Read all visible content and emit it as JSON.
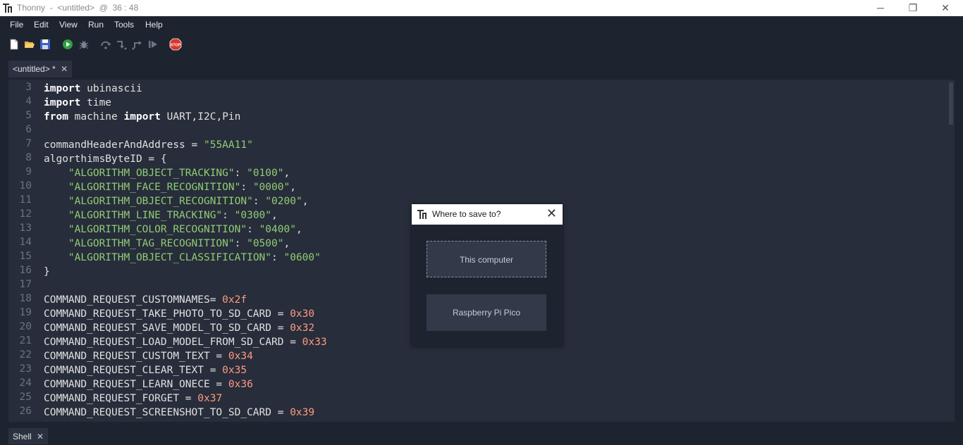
{
  "window": {
    "title": "Thonny  -  <untitled>  @  36 : 48",
    "minimize_glyph": "─",
    "restore_glyph": "❐",
    "close_glyph": "✕"
  },
  "menubar": {
    "items": [
      "File",
      "Edit",
      "View",
      "Run",
      "Tools",
      "Help"
    ]
  },
  "toolbar": {
    "icons": [
      "new-file-icon",
      "open-folder-icon",
      "save-icon",
      "run-icon",
      "debug-icon",
      "step-over-icon",
      "step-into-icon",
      "step-out-icon",
      "resume-icon",
      "stop-icon"
    ],
    "stop_label": "STOP"
  },
  "editor": {
    "tab_label": "<untitled> *",
    "tab_close": "✕",
    "line_numbers": [
      "3",
      "4",
      "5",
      "6",
      "7",
      "8",
      "9",
      "10",
      "11",
      "12",
      "13",
      "14",
      "15",
      "16",
      "17",
      "18",
      "19",
      "20",
      "21",
      "22",
      "23",
      "24",
      "25",
      "26"
    ]
  },
  "code_lines": [
    [
      {
        "t": "import",
        "c": "kw"
      },
      {
        "t": " ubinascii",
        "c": ""
      }
    ],
    [
      {
        "t": "import",
        "c": "kw"
      },
      {
        "t": " time",
        "c": ""
      }
    ],
    [
      {
        "t": "from",
        "c": "kw"
      },
      {
        "t": " machine ",
        "c": ""
      },
      {
        "t": "import",
        "c": "kw"
      },
      {
        "t": " UART,I2C,Pin",
        "c": ""
      }
    ],
    [],
    [
      {
        "t": "commandHeaderAndAddress = ",
        "c": ""
      },
      {
        "t": "\"55AA11\"",
        "c": "str"
      }
    ],
    [
      {
        "t": "algorthimsByteID = {",
        "c": ""
      }
    ],
    [
      {
        "t": "    ",
        "c": ""
      },
      {
        "t": "\"ALGORITHM_OBJECT_TRACKING\"",
        "c": "str"
      },
      {
        "t": ": ",
        "c": ""
      },
      {
        "t": "\"0100\"",
        "c": "str"
      },
      {
        "t": ",",
        "c": ""
      }
    ],
    [
      {
        "t": "    ",
        "c": ""
      },
      {
        "t": "\"ALGORITHM_FACE_RECOGNITION\"",
        "c": "str"
      },
      {
        "t": ": ",
        "c": ""
      },
      {
        "t": "\"0000\"",
        "c": "str"
      },
      {
        "t": ",",
        "c": ""
      }
    ],
    [
      {
        "t": "    ",
        "c": ""
      },
      {
        "t": "\"ALGORITHM_OBJECT_RECOGNITION\"",
        "c": "str"
      },
      {
        "t": ": ",
        "c": ""
      },
      {
        "t": "\"0200\"",
        "c": "str"
      },
      {
        "t": ",",
        "c": ""
      }
    ],
    [
      {
        "t": "    ",
        "c": ""
      },
      {
        "t": "\"ALGORITHM_LINE_TRACKING\"",
        "c": "str"
      },
      {
        "t": ": ",
        "c": ""
      },
      {
        "t": "\"0300\"",
        "c": "str"
      },
      {
        "t": ",",
        "c": ""
      }
    ],
    [
      {
        "t": "    ",
        "c": ""
      },
      {
        "t": "\"ALGORITHM_COLOR_RECOGNITION\"",
        "c": "str"
      },
      {
        "t": ": ",
        "c": ""
      },
      {
        "t": "\"0400\"",
        "c": "str"
      },
      {
        "t": ",",
        "c": ""
      }
    ],
    [
      {
        "t": "    ",
        "c": ""
      },
      {
        "t": "\"ALGORITHM_TAG_RECOGNITION\"",
        "c": "str"
      },
      {
        "t": ": ",
        "c": ""
      },
      {
        "t": "\"0500\"",
        "c": "str"
      },
      {
        "t": ",",
        "c": ""
      }
    ],
    [
      {
        "t": "    ",
        "c": ""
      },
      {
        "t": "\"ALGORITHM_OBJECT_CLASSIFICATION\"",
        "c": "str"
      },
      {
        "t": ": ",
        "c": ""
      },
      {
        "t": "\"0600\"",
        "c": "str"
      }
    ],
    [
      {
        "t": "}",
        "c": ""
      }
    ],
    [],
    [
      {
        "t": "COMMAND_REQUEST_CUSTOMNAMES= ",
        "c": ""
      },
      {
        "t": "0x2f",
        "c": "num"
      }
    ],
    [
      {
        "t": "COMMAND_REQUEST_TAKE_PHOTO_TO_SD_CARD = ",
        "c": ""
      },
      {
        "t": "0x30",
        "c": "num"
      }
    ],
    [
      {
        "t": "COMMAND_REQUEST_SAVE_MODEL_TO_SD_CARD = ",
        "c": ""
      },
      {
        "t": "0x32",
        "c": "num"
      }
    ],
    [
      {
        "t": "COMMAND_REQUEST_LOAD_MODEL_FROM_SD_CARD = ",
        "c": ""
      },
      {
        "t": "0x33",
        "c": "num"
      }
    ],
    [
      {
        "t": "COMMAND_REQUEST_CUSTOM_TEXT = ",
        "c": ""
      },
      {
        "t": "0x34",
        "c": "num"
      }
    ],
    [
      {
        "t": "COMMAND_REQUEST_CLEAR_TEXT = ",
        "c": ""
      },
      {
        "t": "0x35",
        "c": "num"
      }
    ],
    [
      {
        "t": "COMMAND_REQUEST_LEARN_ONECE = ",
        "c": ""
      },
      {
        "t": "0x36",
        "c": "num"
      }
    ],
    [
      {
        "t": "COMMAND_REQUEST_FORGET = ",
        "c": ""
      },
      {
        "t": "0x37",
        "c": "num"
      }
    ],
    [
      {
        "t": "COMMAND_REQUEST_SCREENSHOT_TO_SD_CARD = ",
        "c": ""
      },
      {
        "t": "0x39",
        "c": "num"
      }
    ]
  ],
  "shell": {
    "tab_label": "Shell",
    "tab_close": "✕"
  },
  "dialog": {
    "title": "Where to save to?",
    "close_glyph": "✕",
    "options": [
      "This computer",
      "Raspberry Pi Pico"
    ]
  },
  "colors": {
    "background": "#1e2330",
    "editor_bg": "#272d3a",
    "keyword": "#ffffff",
    "string": "#90cc76",
    "number": "#ff9a84",
    "stop_red": "#d9342b",
    "run_green": "#2ea043"
  }
}
